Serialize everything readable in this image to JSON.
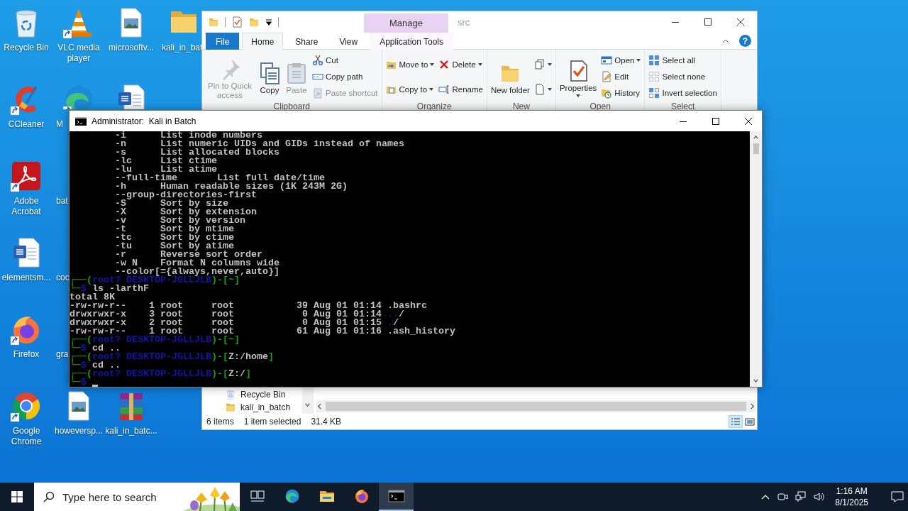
{
  "desktop": {
    "columns": [
      [
        {
          "label": "Recycle Bin",
          "kind": "recycle-bin",
          "shortcut": false,
          "clipped": false
        },
        {
          "label": "CCleaner",
          "kind": "ccleaner",
          "shortcut": true,
          "clipped": false
        },
        {
          "label": "Adobe Acrobat",
          "kind": "acrobat",
          "shortcut": true,
          "clipped": false
        },
        {
          "label": "elementsm...",
          "kind": "word-doc",
          "shortcut": false,
          "clipped": false
        },
        {
          "label": "Firefox",
          "kind": "firefox",
          "shortcut": true,
          "clipped": false
        },
        {
          "label": "Google Chrome",
          "kind": "chrome",
          "shortcut": true,
          "clipped": false
        }
      ],
      [
        {
          "label": "VLC media player",
          "kind": "vlc",
          "shortcut": true,
          "clipped": false
        },
        {
          "label": "M",
          "kind": "edge",
          "shortcut": true,
          "clipped": true
        },
        {
          "label": "bat",
          "kind": "blank",
          "clipped": true
        },
        {
          "label": "coc",
          "kind": "blank",
          "clipped": true
        },
        {
          "label": "gra",
          "kind": "blank",
          "clipped": true
        },
        {
          "label": "howeversp...",
          "kind": "image-file",
          "shortcut": false,
          "clipped": false
        }
      ],
      [
        {
          "label": "microsoftv...",
          "kind": "image-file",
          "shortcut": false,
          "clipped": false
        },
        {
          "kind": "word-doc",
          "shortcut": false,
          "clipped": true
        },
        {
          "kind": "blank"
        },
        {
          "kind": "blank"
        },
        {
          "kind": "blank"
        },
        {
          "label": "kali_in_batc...",
          "kind": "winrar",
          "shortcut": false,
          "clipped": false
        }
      ],
      [
        {
          "label": "kali_in_bat",
          "kind": "folder",
          "shortcut": false,
          "clipped": true
        }
      ]
    ]
  },
  "explorer": {
    "context_tab": "Manage",
    "title": "src",
    "help": "?",
    "tabs": [
      {
        "label": "File",
        "kind": "file",
        "selected": false
      },
      {
        "label": "Home",
        "kind": "normal",
        "selected": true
      },
      {
        "label": "Share",
        "kind": "normal",
        "selected": false
      },
      {
        "label": "View",
        "kind": "normal",
        "selected": false
      },
      {
        "label": "Application Tools",
        "kind": "context",
        "selected": false
      }
    ],
    "groups": [
      {
        "label": "Clipboard",
        "stacks": [
          [
            {
              "label": "Pin to Quick access",
              "kind": "pin",
              "disabled": true,
              "dropdown": false
            }
          ],
          [
            {
              "label": "Copy",
              "kind": "copy",
              "disabled": false,
              "dropdown": false
            }
          ],
          [
            {
              "label": "Paste",
              "kind": "paste",
              "disabled": true,
              "dropdown": false
            }
          ],
          [
            {
              "label": "Cut",
              "kind": "scissors",
              "disabled": false,
              "dropdown": false
            },
            {
              "label": "Copy path",
              "kind": "path",
              "disabled": false,
              "dropdown": false
            },
            {
              "label": "Paste shortcut",
              "kind": "paste-shortcut",
              "disabled": true,
              "dropdown": false
            }
          ]
        ]
      },
      {
        "label": "Organize",
        "stacks": [
          [
            {
              "label": "Move to",
              "kind": "move",
              "disabled": false,
              "dropdown": true
            },
            {
              "label": "Copy to",
              "kind": "copy-to",
              "disabled": false,
              "dropdown": true
            }
          ],
          [
            {
              "label": "Delete",
              "kind": "delete",
              "disabled": false,
              "dropdown": true
            },
            {
              "label": "Rename",
              "kind": "rename",
              "disabled": false,
              "dropdown": false
            }
          ]
        ]
      },
      {
        "label": "New",
        "stacks": [
          [
            {
              "label": "New folder",
              "kind": "new-folder",
              "disabled": false,
              "dropdown": false
            }
          ],
          [
            {
              "kind": "new-item",
              "disabled": false,
              "dropdown": true
            },
            {
              "kind": "easy-access",
              "disabled": false,
              "dropdown": true
            }
          ]
        ]
      },
      {
        "label": "Open",
        "stacks": [
          [
            {
              "label": "Properties",
              "kind": "properties",
              "disabled": false,
              "dropdown": true
            }
          ],
          [
            {
              "label": "Open",
              "kind": "open",
              "disabled": false,
              "dropdown": true
            },
            {
              "label": "Edit",
              "kind": "edit",
              "disabled": false,
              "dropdown": false
            },
            {
              "label": "History",
              "kind": "history",
              "disabled": false,
              "dropdown": false
            }
          ]
        ]
      },
      {
        "label": "Select",
        "stacks": [
          [
            {
              "label": "Select all",
              "kind": "select-all",
              "disabled": false,
              "dropdown": false
            },
            {
              "label": "Select none",
              "kind": "select-none",
              "disabled": false,
              "dropdown": false
            },
            {
              "label": "Invert selection",
              "kind": "invert",
              "disabled": false,
              "dropdown": false
            }
          ]
        ]
      }
    ],
    "nav_items": [
      {
        "label": "Recycle Bin",
        "kind": "recycle-bin"
      },
      {
        "label": "kali_in_batch",
        "kind": "folder"
      }
    ],
    "status": {
      "items": "6 items",
      "selection": "1 item selected",
      "size": "31.4 KB"
    },
    "views": [
      {
        "kind": "details",
        "selected": true
      },
      {
        "kind": "large-icons",
        "selected": false
      }
    ]
  },
  "console": {
    "title": "Administrator:  Kali in Batch",
    "cursor": true,
    "lines": [
      [
        {
          "text": "        -i      List inode numbers",
          "kind": "text"
        }
      ],
      [
        {
          "text": "        -n      List numeric UIDs and GIDs instead of names",
          "kind": "text"
        }
      ],
      [
        {
          "text": "        -s      List allocated blocks",
          "kind": "text"
        }
      ],
      [
        {
          "text": "        -lc     List ctime",
          "kind": "text"
        }
      ],
      [
        {
          "text": "        -lu     List atime",
          "kind": "text"
        }
      ],
      [
        {
          "text": "        --full-time       List full date/time",
          "kind": "text"
        }
      ],
      [
        {
          "text": "        -h      Human readable sizes (1K 243M 2G)",
          "kind": "text"
        }
      ],
      [
        {
          "text": "        --group-directories-first",
          "kind": "text"
        }
      ],
      [
        {
          "text": "        -S      Sort by size",
          "kind": "text"
        }
      ],
      [
        {
          "text": "        -X      Sort by extension",
          "kind": "text"
        }
      ],
      [
        {
          "text": "        -v      Sort by version",
          "kind": "text"
        }
      ],
      [
        {
          "text": "        -t      Sort by mtime",
          "kind": "text"
        }
      ],
      [
        {
          "text": "        -tc     Sort by ctime",
          "kind": "text"
        }
      ],
      [
        {
          "text": "        -tu     Sort by atime",
          "kind": "text"
        }
      ],
      [
        {
          "text": "        -r      Reverse sort order",
          "kind": "text"
        }
      ],
      [
        {
          "text": "        -w N    Format N columns wide",
          "kind": "text"
        }
      ],
      [
        {
          "text": "        --color[={always,never,auto}]",
          "kind": "text"
        }
      ],
      [
        {
          "text": "┌──(",
          "kind": "frame"
        },
        {
          "text": "root? DESKTOP-JGLLJLB",
          "kind": "user"
        },
        {
          "text": ")-[~]",
          "kind": "frame"
        }
      ],
      [
        {
          "text": "└─",
          "kind": "frame"
        },
        {
          "text": "$",
          "kind": "user"
        },
        {
          "text": " ls -larthF",
          "kind": "text"
        }
      ],
      [
        {
          "text": "total 8K",
          "kind": "text"
        }
      ],
      [
        {
          "text": "-rw-rw-r--    1 root     root           39 Aug 01 01:14 .bashrc",
          "kind": "text"
        }
      ],
      [
        {
          "text": "drwxrwxr-x    3 root     root            0 Aug 01 01:14 ",
          "kind": "text"
        },
        {
          "text": "..",
          "kind": "user"
        },
        {
          "text": "/",
          "kind": "text"
        }
      ],
      [
        {
          "text": "drwxrwxr-x    2 root     root            0 Aug 01 01:15 ",
          "kind": "text"
        },
        {
          "text": ".",
          "kind": "user"
        },
        {
          "text": "/",
          "kind": "text"
        }
      ],
      [
        {
          "text": "-rw-rw-r--    1 root     root           61 Aug 01 01:16 .ash_history",
          "kind": "text"
        }
      ],
      [
        {
          "text": "┌──(",
          "kind": "frame"
        },
        {
          "text": "root? DESKTOP-JGLLJLB",
          "kind": "user"
        },
        {
          "text": ")-[~]",
          "kind": "frame"
        }
      ],
      [
        {
          "text": "└─",
          "kind": "frame"
        },
        {
          "text": "$",
          "kind": "user"
        },
        {
          "text": " cd ..",
          "kind": "text"
        }
      ],
      [
        {
          "text": "┌──(",
          "kind": "frame"
        },
        {
          "text": "root? DESKTOP-JGLLJLB",
          "kind": "user"
        },
        {
          "text": ")-[",
          "kind": "frame"
        },
        {
          "text": "Z:/home",
          "kind": "text"
        },
        {
          "text": "]",
          "kind": "frame"
        }
      ],
      [
        {
          "text": "└─",
          "kind": "frame"
        },
        {
          "text": "$",
          "kind": "user"
        },
        {
          "text": " cd ..",
          "kind": "text"
        }
      ],
      [
        {
          "text": "┌──(",
          "kind": "frame"
        },
        {
          "text": "root? DESKTOP-JGLLJLB",
          "kind": "user"
        },
        {
          "text": ")-[",
          "kind": "frame"
        },
        {
          "text": "Z:/",
          "kind": "text"
        },
        {
          "text": "]",
          "kind": "frame"
        }
      ],
      [
        {
          "text": "└─",
          "kind": "frame"
        },
        {
          "text": "$",
          "kind": "user"
        }
      ]
    ]
  },
  "taskbar": {
    "search_placeholder": "Type here to search",
    "apps": [
      {
        "kind": "task-view",
        "active": false
      },
      {
        "kind": "edge",
        "active": false
      },
      {
        "kind": "explorer",
        "active": false
      },
      {
        "kind": "firefox",
        "active": false
      },
      {
        "kind": "terminal",
        "active": true
      }
    ],
    "time": "1:16 AM",
    "date": "8/1/2025"
  }
}
